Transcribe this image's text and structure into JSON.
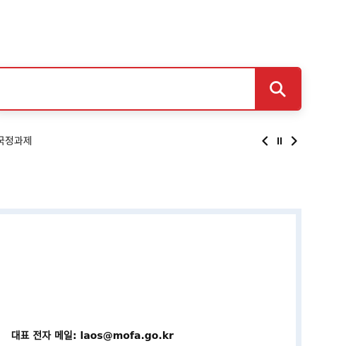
{
  "search": {
    "value": "",
    "placeholder": ""
  },
  "keywords": {
    "current": "국정과제"
  },
  "contact": {
    "email_label": "대표 전자 메일:",
    "email_value": "laos@mofa.go.kr"
  },
  "colors": {
    "accent": "#d7262b",
    "panel_border": "#e8eff7",
    "text": "#222222"
  },
  "icons": {
    "search": "search-icon",
    "prev": "chevron-left-icon",
    "pause": "pause-icon",
    "next": "chevron-right-icon"
  }
}
